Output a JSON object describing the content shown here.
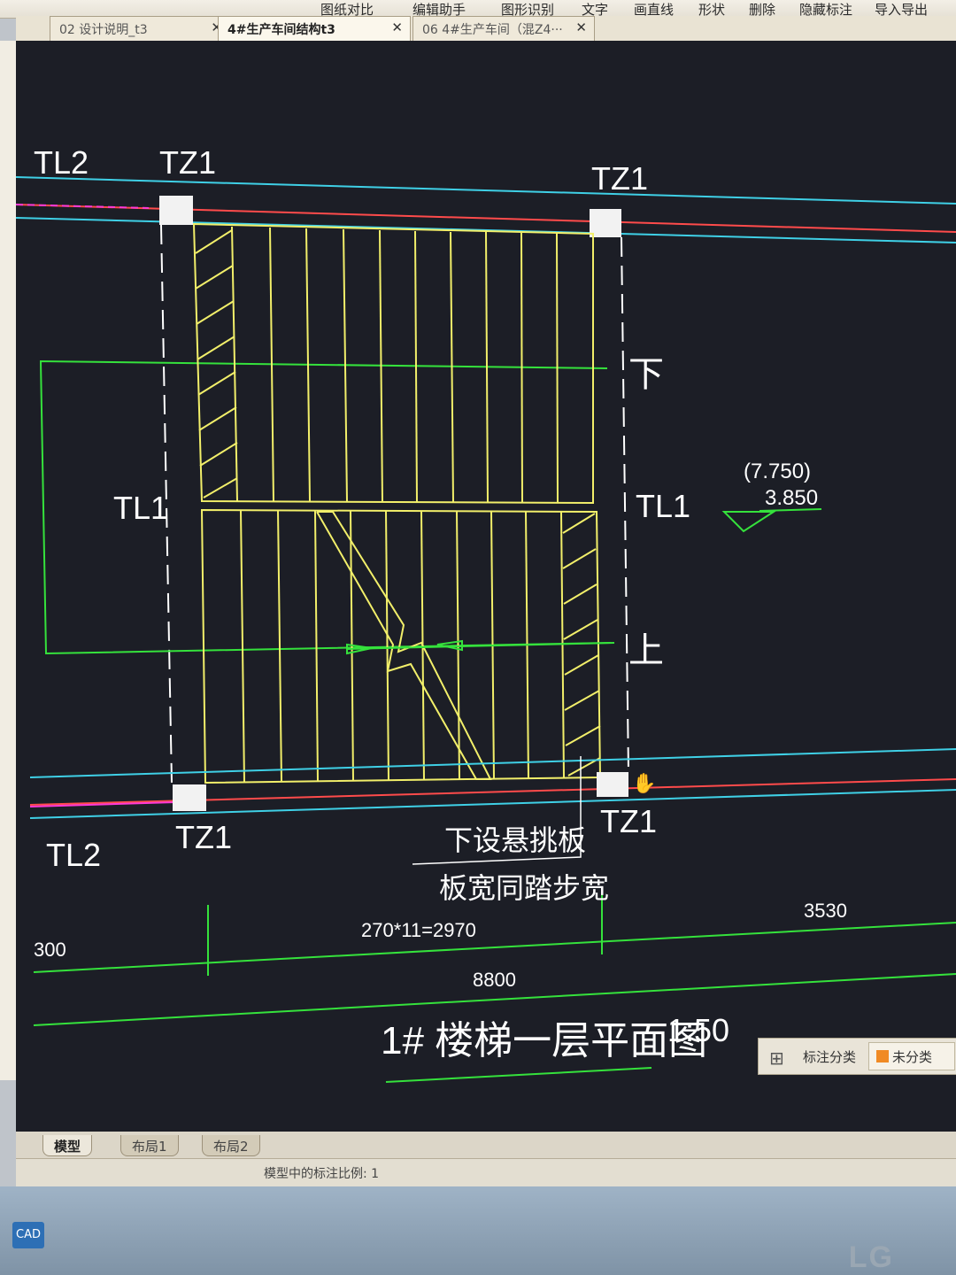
{
  "ribbon": {
    "items": [
      "图纸对比",
      "编辑助手",
      "图形识别",
      "文字",
      "画直线",
      "形状",
      "删除",
      "隐藏标注",
      "导入导出"
    ]
  },
  "tabs": [
    {
      "label": "02 设计说明_t3",
      "active": false
    },
    {
      "label": "4#生产车间结构t3",
      "active": true
    },
    {
      "label": "06 4#生产车间（混Z4···",
      "active": false
    }
  ],
  "drawing": {
    "labels": {
      "tl2_top": "TL2",
      "tz1_top_left": "TZ1",
      "tz1_top_right": "TZ1",
      "tl1_left": "TL1",
      "tl1_right": "TL1",
      "down": "下",
      "up": "上",
      "tz1_bottom_left": "TZ1",
      "tz1_bottom_right": "TZ1",
      "tl2_bottom": "TL2",
      "elev_upper": "(7.750)",
      "elev_lower": "3.850",
      "note_line1": "下设悬挑板",
      "note_line2": "板宽同踏步宽",
      "dim_300": "300",
      "dim_steps": "270*11=2970",
      "dim_3530": "3530",
      "dim_8800": "8800",
      "title": "1# 楼梯一层平面图",
      "scale": "1:50",
      "bottom_partial_left": "TL2",
      "bottom_partial_mid": "TZ1",
      "bottom_partial_right": "TZ1"
    },
    "colors": {
      "background": "#1c1e26",
      "cyan": "#3fd0e6",
      "red": "#ff4b4b",
      "magenta": "#ff39d6",
      "yellow": "#f2ef6a",
      "green": "#35e23c",
      "white": "#ffffff"
    }
  },
  "legend_panel": {
    "label": "标注分类",
    "chip": "未分类",
    "chip_color": "#f08a24"
  },
  "layout_tabs": [
    {
      "label": "模型",
      "active": true
    },
    {
      "label": "布局1",
      "active": false
    },
    {
      "label": "布局2",
      "active": false
    }
  ],
  "status": {
    "text": "模型中的标注比例: 1"
  },
  "taskbar": {
    "button": "CAD",
    "brand": "LG"
  }
}
